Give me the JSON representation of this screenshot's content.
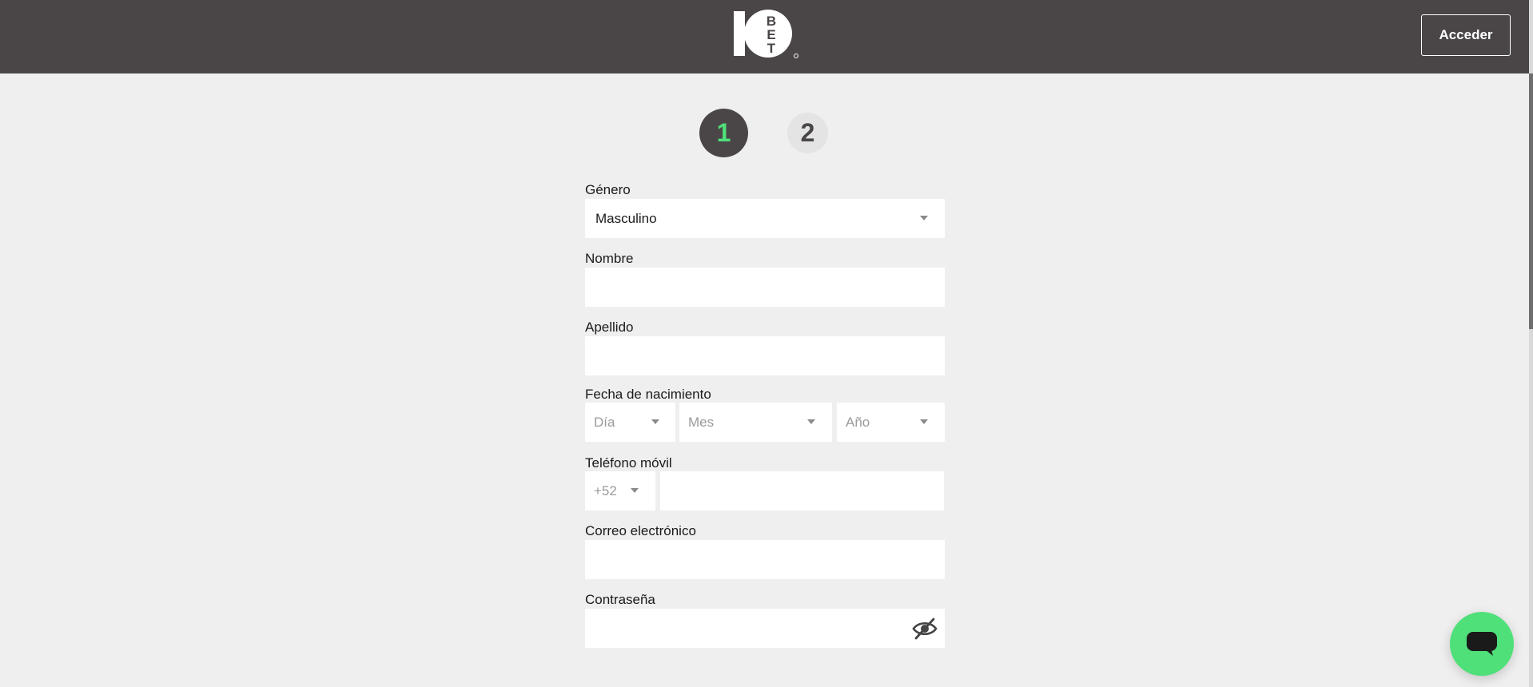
{
  "header": {
    "logo_text": "10 BET",
    "login_label": "Acceder"
  },
  "steps": [
    {
      "number": "1",
      "active": true
    },
    {
      "number": "2",
      "active": false
    }
  ],
  "form": {
    "gender": {
      "label": "Género",
      "value": "Masculino"
    },
    "first_name": {
      "label": "Nombre",
      "value": ""
    },
    "last_name": {
      "label": "Apellido",
      "value": ""
    },
    "birth_date": {
      "label": "Fecha de nacimiento",
      "day_placeholder": "Día",
      "month_placeholder": "Mes",
      "year_placeholder": "Año"
    },
    "phone": {
      "label": "Teléfono móvil",
      "country_code": "+52",
      "value": ""
    },
    "email": {
      "label": "Correo electrónico",
      "value": ""
    },
    "password": {
      "label": "Contraseña",
      "value": ""
    }
  },
  "colors": {
    "header_bg": "#4a4648",
    "accent_green": "#4fe07a",
    "page_bg": "#efefef"
  },
  "icons": {
    "dropdown": "chevron-down-icon",
    "password_toggle": "eye-off-icon",
    "chat": "chat-bubble-icon"
  }
}
